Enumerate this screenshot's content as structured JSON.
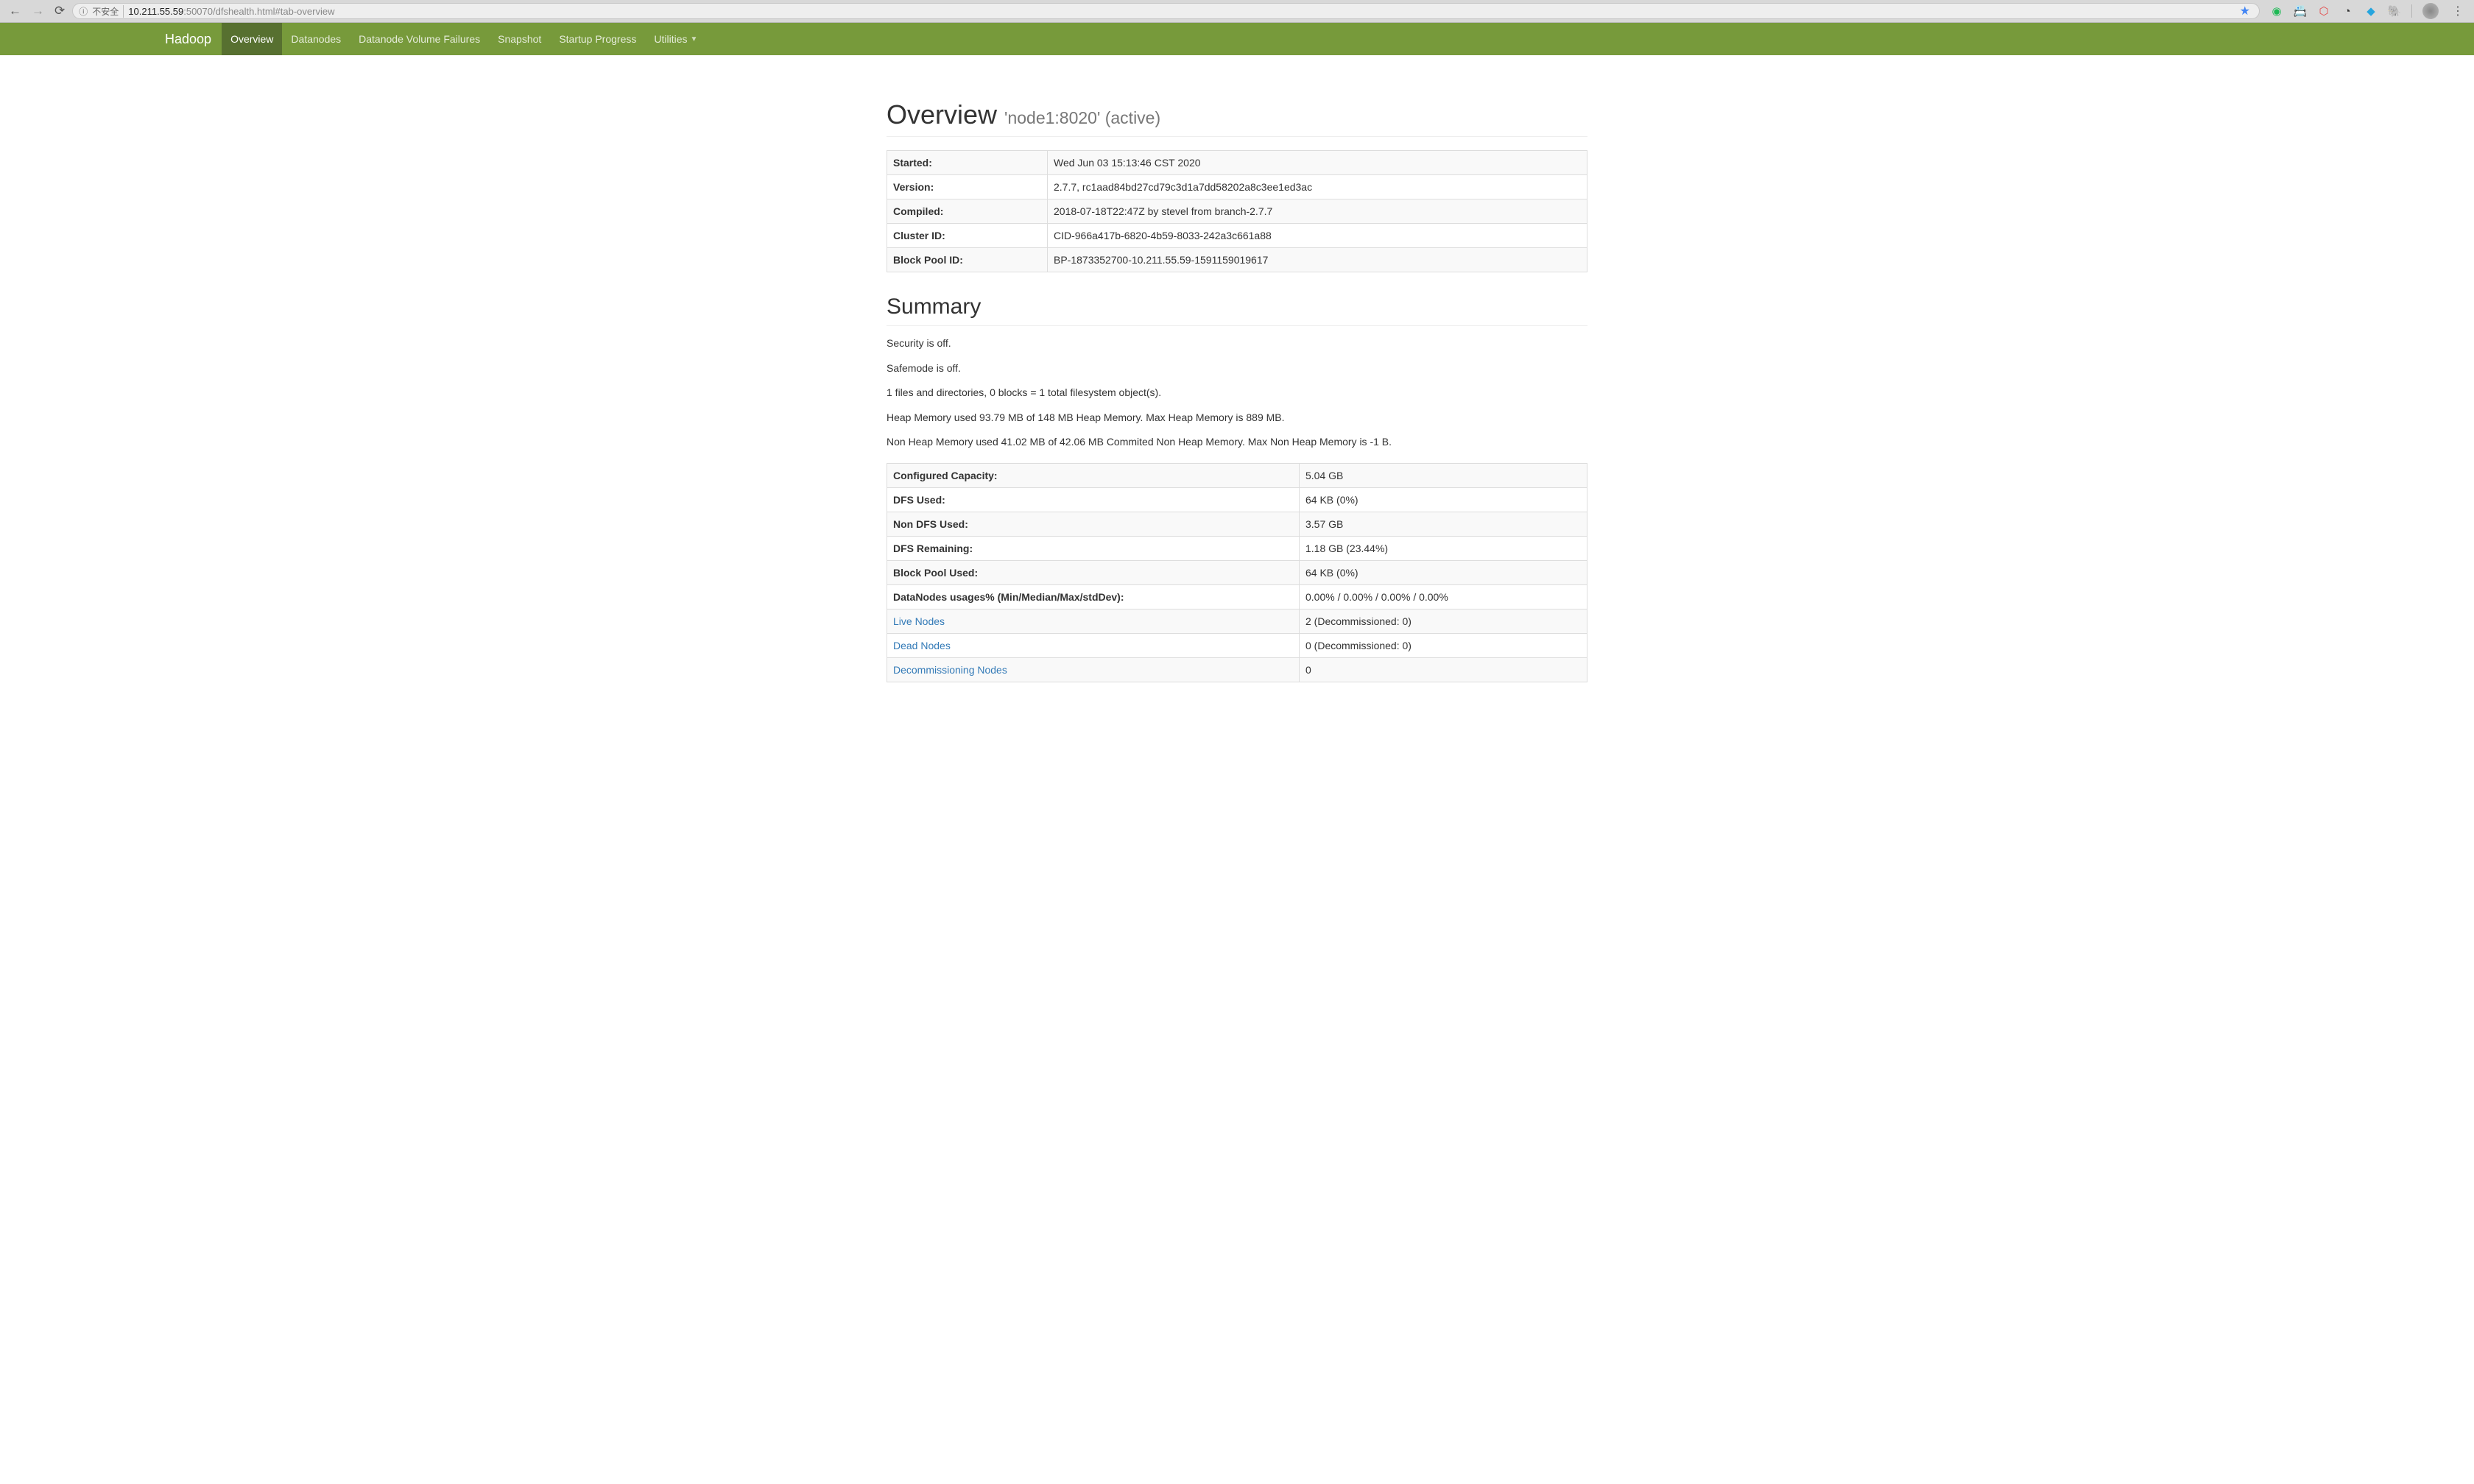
{
  "browser": {
    "security_text": "不安全",
    "url_host": "10.211.55.59",
    "url_path": ":50070/dfshealth.html#tab-overview"
  },
  "navbar": {
    "brand": "Hadoop",
    "items": [
      {
        "label": "Overview",
        "active": true
      },
      {
        "label": "Datanodes",
        "active": false
      },
      {
        "label": "Datanode Volume Failures",
        "active": false
      },
      {
        "label": "Snapshot",
        "active": false
      },
      {
        "label": "Startup Progress",
        "active": false
      },
      {
        "label": "Utilities",
        "active": false,
        "dropdown": true
      }
    ]
  },
  "overview": {
    "title": "Overview",
    "subtitle": "'node1:8020' (active)",
    "rows": [
      {
        "label": "Started:",
        "value": "Wed Jun 03 15:13:46 CST 2020"
      },
      {
        "label": "Version:",
        "value": "2.7.7, rc1aad84bd27cd79c3d1a7dd58202a8c3ee1ed3ac"
      },
      {
        "label": "Compiled:",
        "value": "2018-07-18T22:47Z by stevel from branch-2.7.7"
      },
      {
        "label": "Cluster ID:",
        "value": "CID-966a417b-6820-4b59-8033-242a3c661a88"
      },
      {
        "label": "Block Pool ID:",
        "value": "BP-1873352700-10.211.55.59-1591159019617"
      }
    ]
  },
  "summary": {
    "title": "Summary",
    "text_lines": [
      "Security is off.",
      "Safemode is off.",
      "1 files and directories, 0 blocks = 1 total filesystem object(s).",
      "Heap Memory used 93.79 MB of 148 MB Heap Memory. Max Heap Memory is 889 MB.",
      "Non Heap Memory used 41.02 MB of 42.06 MB Commited Non Heap Memory. Max Non Heap Memory is -1 B."
    ],
    "rows": [
      {
        "label": "Configured Capacity:",
        "value": "5.04 GB",
        "link": false
      },
      {
        "label": "DFS Used:",
        "value": "64 KB (0%)",
        "link": false
      },
      {
        "label": "Non DFS Used:",
        "value": "3.57 GB",
        "link": false
      },
      {
        "label": "DFS Remaining:",
        "value": "1.18 GB (23.44%)",
        "link": false
      },
      {
        "label": "Block Pool Used:",
        "value": "64 KB (0%)",
        "link": false
      },
      {
        "label": "DataNodes usages% (Min/Median/Max/stdDev):",
        "value": "0.00% / 0.00% / 0.00% / 0.00%",
        "link": false
      },
      {
        "label": "Live Nodes",
        "value": "2 (Decommissioned: 0)",
        "link": true
      },
      {
        "label": "Dead Nodes",
        "value": "0 (Decommissioned: 0)",
        "link": true
      },
      {
        "label": "Decommissioning Nodes",
        "value": "0",
        "link": true
      }
    ]
  }
}
